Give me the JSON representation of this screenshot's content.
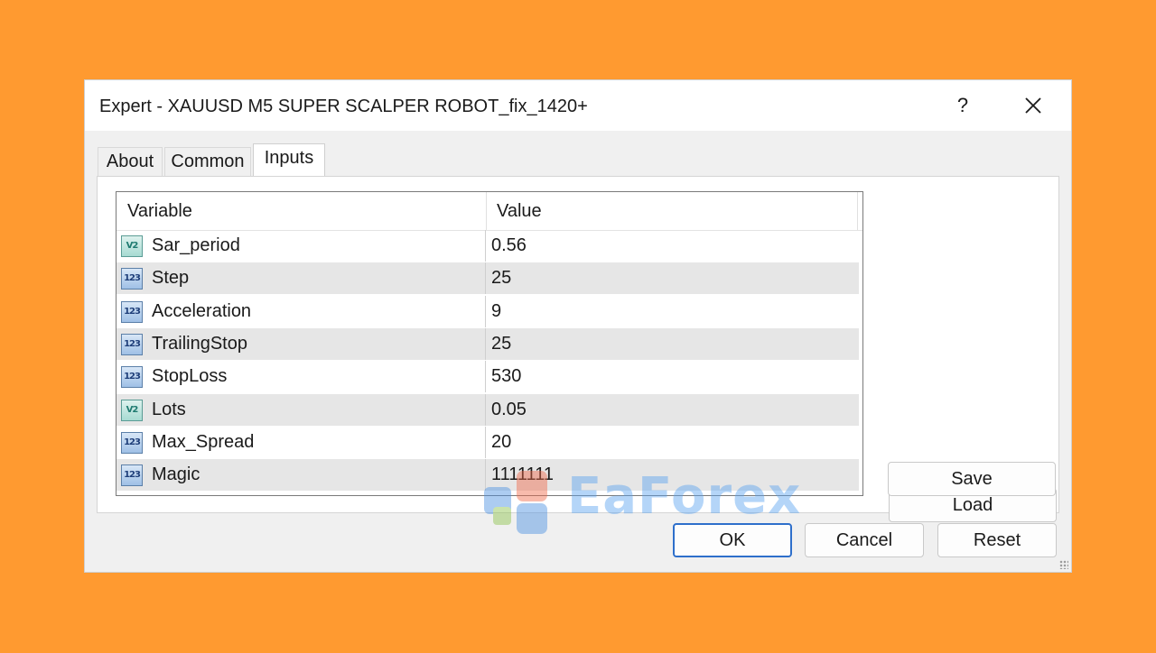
{
  "window": {
    "title": "Expert - XAUUSD M5 SUPER SCALPER ROBOT_fix_1420+",
    "help": "?",
    "close": "✕"
  },
  "tabs": [
    {
      "label": "About"
    },
    {
      "label": "Common"
    },
    {
      "label": "Inputs",
      "active": true
    }
  ],
  "grid": {
    "headers": {
      "variable": "Variable",
      "value": "Value"
    },
    "rows": [
      {
        "icon": "double-type-icon",
        "badge": "V2",
        "variable": "Sar_period",
        "value": "0.56"
      },
      {
        "icon": "integer-type-icon",
        "badge": "123",
        "variable": "Step",
        "value": "25"
      },
      {
        "icon": "integer-type-icon",
        "badge": "123",
        "variable": "Acceleration",
        "value": "9"
      },
      {
        "icon": "integer-type-icon",
        "badge": "123",
        "variable": "TrailingStop",
        "value": "25"
      },
      {
        "icon": "integer-type-icon",
        "badge": "123",
        "variable": "StopLoss",
        "value": "530"
      },
      {
        "icon": "double-type-icon",
        "badge": "V2",
        "variable": "Lots",
        "value": "0.05"
      },
      {
        "icon": "integer-type-icon",
        "badge": "123",
        "variable": "Max_Spread",
        "value": "20"
      },
      {
        "icon": "integer-type-icon",
        "badge": "123",
        "variable": "Magic",
        "value": "1111111"
      }
    ]
  },
  "side_buttons": {
    "load": "Load",
    "save": "Save"
  },
  "footer_buttons": {
    "ok": "OK",
    "cancel": "Cancel",
    "reset": "Reset"
  },
  "watermark": {
    "text": "EaForex"
  },
  "colors": {
    "background": "#FF9A30",
    "accent": "#2E6FCB",
    "alt_row": "#E6E6E6"
  }
}
